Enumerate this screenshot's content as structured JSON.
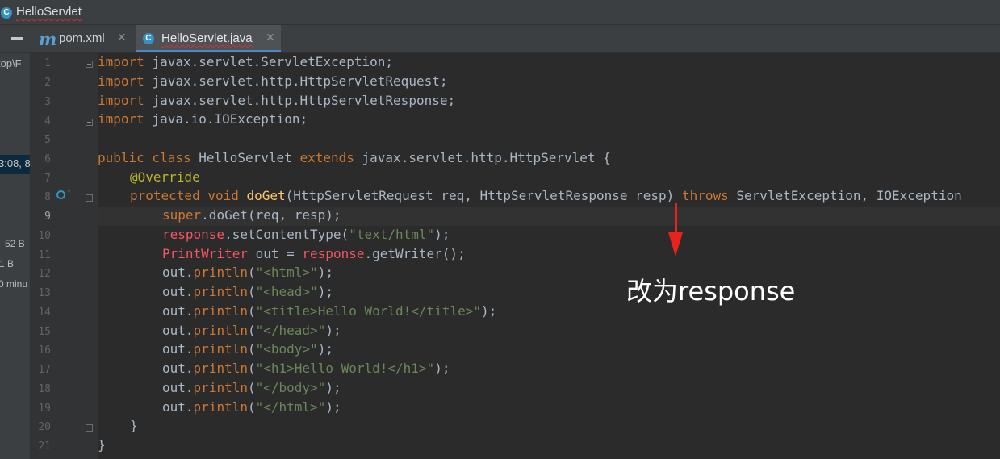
{
  "window": {
    "title": "HelloServlet"
  },
  "tabs": [
    {
      "label": "pom.xml",
      "icon": "maven-icon"
    },
    {
      "label": "HelloServlet.java",
      "icon": "java-class-icon",
      "active": true
    }
  ],
  "left_panel": {
    "path_fragment": "top\\F",
    "time_fragment": "3:08, 8",
    "size1": "52 B",
    "size2": "1 B",
    "minutes": "0 minu"
  },
  "editor": {
    "line_numbers": [
      "1",
      "2",
      "3",
      "4",
      "5",
      "6",
      "7",
      "8",
      "9",
      "10",
      "11",
      "12",
      "13",
      "14",
      "15",
      "16",
      "17",
      "18",
      "19",
      "20",
      "21"
    ],
    "current_line": "9",
    "code": {
      "l1": {
        "kw": "import",
        "rest": " javax.servlet.ServletException;"
      },
      "l2": {
        "kw": "import",
        "rest": " javax.servlet.http.HttpServletRequest;"
      },
      "l3": {
        "kw": "import",
        "rest": " javax.servlet.http.HttpServletResponse;"
      },
      "l4": {
        "kw": "import",
        "rest": " java.io.IOException;"
      },
      "l6": {
        "kw1": "public class",
        "name": " HelloServlet ",
        "kw2": "extends",
        "rest": " javax.servlet.http.HttpServlet {"
      },
      "l7": {
        "annotation": "@Override"
      },
      "l8": {
        "kw1": "protected void",
        "method": " doGet",
        "params": "(HttpServletRequest req, HttpServletResponse resp) ",
        "kw2": "throws",
        "rest": " ServletException, IOException"
      },
      "l9": {
        "kw": "super",
        "rest": ".doGet(req, resp);"
      },
      "l10": {
        "err": "response",
        "rest": ".setContentType(",
        "str": "\"text/html\"",
        "end": ");"
      },
      "l11": {
        "err1": "PrintWriter",
        "mid": " out = ",
        "err2": "response",
        "rest": ".getWriter();"
      },
      "l12": {
        "str": "\"<html>\""
      },
      "l13": {
        "str": "\"<head>\""
      },
      "l14": {
        "str": "\"<title>Hello World!</title>\""
      },
      "l15": {
        "str": "\"</head>\""
      },
      "l16": {
        "str": "\"<body>\""
      },
      "l17": {
        "str": "\"<h1>Hello World!</h1>\""
      },
      "l18": {
        "str": "\"</body>\""
      },
      "l19": {
        "str": "\"</html>\""
      },
      "println_obj": "out",
      "println_dot": ".",
      "println_name": "println",
      "l20": "}",
      "l21": "}"
    }
  },
  "annotation": {
    "text": "改为response",
    "arrow_color": "#e8231b"
  },
  "colors": {
    "keyword": "#cc7832",
    "string": "#6a8759",
    "annotation": "#bbb529",
    "method_decl": "#ffc66d",
    "error": "#f75464",
    "accent": "#4a88c7"
  }
}
